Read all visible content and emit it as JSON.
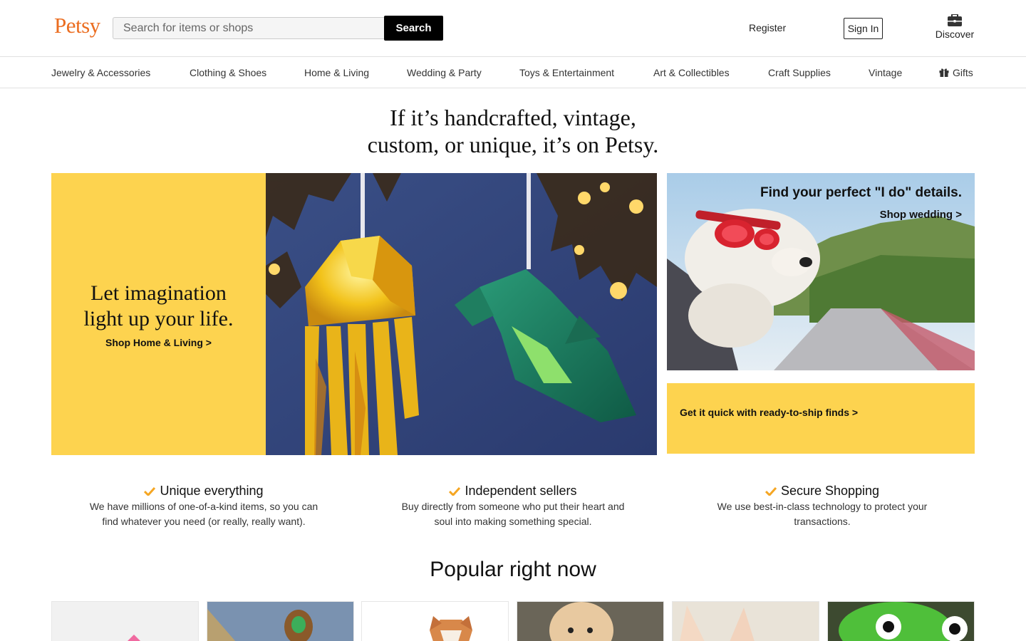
{
  "header": {
    "logo": "Petsy",
    "search_placeholder": "Search for items or shops",
    "search_button": "Search",
    "register": "Register",
    "sign_in": "Sign In",
    "discover": "Discover"
  },
  "nav": {
    "items": [
      "Jewelry & Accessories",
      "Clothing & Shoes",
      "Home & Living",
      "Wedding & Party",
      "Toys & Entertainment",
      "Art & Collectibles",
      "Craft Supplies",
      "Vintage",
      "Gifts"
    ]
  },
  "hero": {
    "line1": "If it’s handcrafted, vintage,",
    "line2": "custom, or unique, it’s on Petsy."
  },
  "banner": {
    "title_line1": "Let imagination",
    "title_line2": "light up your life.",
    "link": "Shop Home & Living >"
  },
  "wedding": {
    "title": "Find your perfect \"I do\" details.",
    "link": "Shop wedding >"
  },
  "quick": {
    "link": "Get it quick with ready-to-ship finds >"
  },
  "props": [
    {
      "title": "Unique everything",
      "desc_line1": "We have millions of one-of-a-kind items, so you can",
      "desc_line2": "find whatever you need (or really, really want)."
    },
    {
      "title": "Independent sellers",
      "desc_line1": "Buy directly from someone who put their heart and",
      "desc_line2": "soul into making something special."
    },
    {
      "title": "Secure Shopping",
      "desc_line1": "We use best-in-class technology to protect your",
      "desc_line2": "transactions."
    }
  ],
  "popular": {
    "heading": "Popular right now"
  },
  "colors": {
    "brand": "#eb6d20",
    "banner_yellow": "#fdd34f",
    "check": "#f5a623"
  }
}
